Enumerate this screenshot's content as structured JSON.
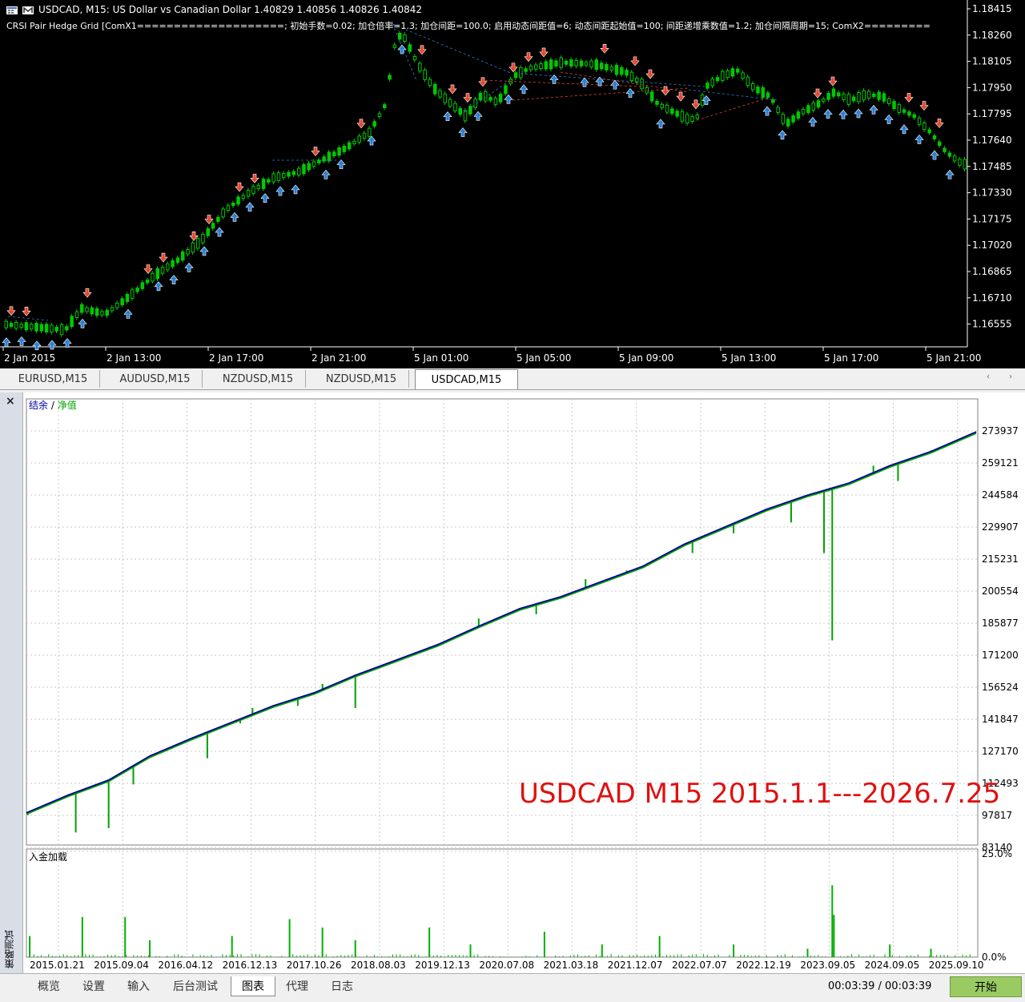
{
  "title": {
    "symbol": "USDCAD, M15:",
    "description": "US Dollar vs Canadian Dollar",
    "quotes": "1.40829 1.40856 1.40826 1.40842"
  },
  "indicator_line": "CRSI Pair Hedge Grid [ComX1====================; 初始手数=0.02; 加仓倍率=1.3; 加仓间距=100.0; 启用动态间距值=6; 动态间距起始值=100; 间距递增乘数值=1.2; 加仓间隔周期=15; ComX2=========",
  "price_axis": [
    "1.18415",
    "1.18260",
    "1.18105",
    "1.17950",
    "1.17795",
    "1.17640",
    "1.17485",
    "1.17330",
    "1.17175",
    "1.17020",
    "1.16865",
    "1.16710",
    "1.16555"
  ],
  "time_axis": [
    "2 Jan 2015",
    "2 Jan 13:00",
    "2 Jan 17:00",
    "2 Jan 21:00",
    "5 Jan 01:00",
    "5 Jan 05:00",
    "5 Jan 09:00",
    "5 Jan 13:00",
    "5 Jan 17:00",
    "5 Jan 21:00"
  ],
  "chart_tabs": [
    {
      "label": "EURUSD,M15",
      "active": false
    },
    {
      "label": "AUDUSD,M15",
      "active": false
    },
    {
      "label": "NZDUSD,M15",
      "active": false
    },
    {
      "label": "NZDUSD,M15",
      "active": false
    },
    {
      "label": "USDCAD,M15",
      "active": true
    }
  ],
  "tester": {
    "legend_balance": "结余",
    "legend_sep": " / ",
    "legend_equity": "净值",
    "deposit_label": "入金加载",
    "side_label": "策略测试",
    "close_icon": "×",
    "annotation": "USDCAD M15 2015.1.1---2026.7.25",
    "balance_axis": [
      "273937",
      "259121",
      "244584",
      "229907",
      "215231",
      "200554",
      "185877",
      "171200",
      "156524",
      "141847",
      "127170",
      "112493",
      "97817",
      "83140"
    ],
    "deposit_axis": [
      "25.0%",
      "0.0%"
    ],
    "date_axis": [
      "2015.01.21",
      "2015.09.04",
      "2016.04.12",
      "2016.12.13",
      "2017.10.26",
      "2018.08.03",
      "2019.12.13",
      "2020.07.08",
      "2021.03.18",
      "2021.12.07",
      "2022.07.07",
      "2022.12.19",
      "2023.09.05",
      "2024.09.05",
      "2025.09.10"
    ]
  },
  "bottom_tabs": [
    {
      "label": "概览",
      "active": false
    },
    {
      "label": "设置",
      "active": false
    },
    {
      "label": "输入",
      "active": false
    },
    {
      "label": "后台测试",
      "active": false
    },
    {
      "label": "图表",
      "active": true
    },
    {
      "label": "代理",
      "active": false
    },
    {
      "label": "日志",
      "active": false
    }
  ],
  "timer": "00:03:39 / 00:03:39",
  "start_button": "开始",
  "colors": {
    "balance": "#0000a0",
    "equity": "#00a000",
    "deposit": "#00b000",
    "bull_candle": "#00c800",
    "buy_arrow": "#2a7fd4",
    "sell_arrow": "#e8452c",
    "annotation": "#e01010",
    "start_button": "#9acb63"
  },
  "chart_data": [
    {
      "type": "line",
      "series": [
        {
          "name": "结余",
          "x": [
            2015.0,
            2015.5,
            2016.0,
            2016.5,
            2017.0,
            2017.5,
            2018.0,
            2018.5,
            2019.0,
            2019.5,
            2020.0,
            2020.5,
            2021.0,
            2021.5,
            2022.0,
            2022.5,
            2023.0,
            2023.5,
            2024.0,
            2024.5,
            2025.0,
            2025.5,
            2026.0,
            2026.55
          ],
          "values": [
            99000,
            107000,
            114000,
            125000,
            133000,
            140500,
            148000,
            154000,
            162000,
            169000,
            176000,
            184500,
            192500,
            198000,
            205000,
            212000,
            222000,
            230000,
            238000,
            244500,
            250000,
            258000,
            264500,
            273500
          ]
        },
        {
          "name": "净值",
          "x": [
            2015.0,
            2015.5,
            2016.0,
            2016.5,
            2017.0,
            2017.5,
            2018.0,
            2018.5,
            2019.0,
            2019.5,
            2020.0,
            2020.5,
            2021.0,
            2021.5,
            2022.0,
            2022.5,
            2023.0,
            2023.5,
            2024.0,
            2024.5,
            2025.0,
            2025.5,
            2026.0,
            2026.55
          ],
          "values": [
            98500,
            106500,
            113500,
            124500,
            132500,
            140000,
            147500,
            153500,
            161500,
            168500,
            175500,
            184000,
            192000,
            197500,
            204500,
            211500,
            221500,
            229500,
            237500,
            244000,
            249500,
            257500,
            264000,
            273000
          ]
        }
      ],
      "ylim": [
        83140,
        280000
      ]
    },
    {
      "type": "bar",
      "title": "入金加载",
      "ylim": [
        0,
        25
      ]
    }
  ]
}
